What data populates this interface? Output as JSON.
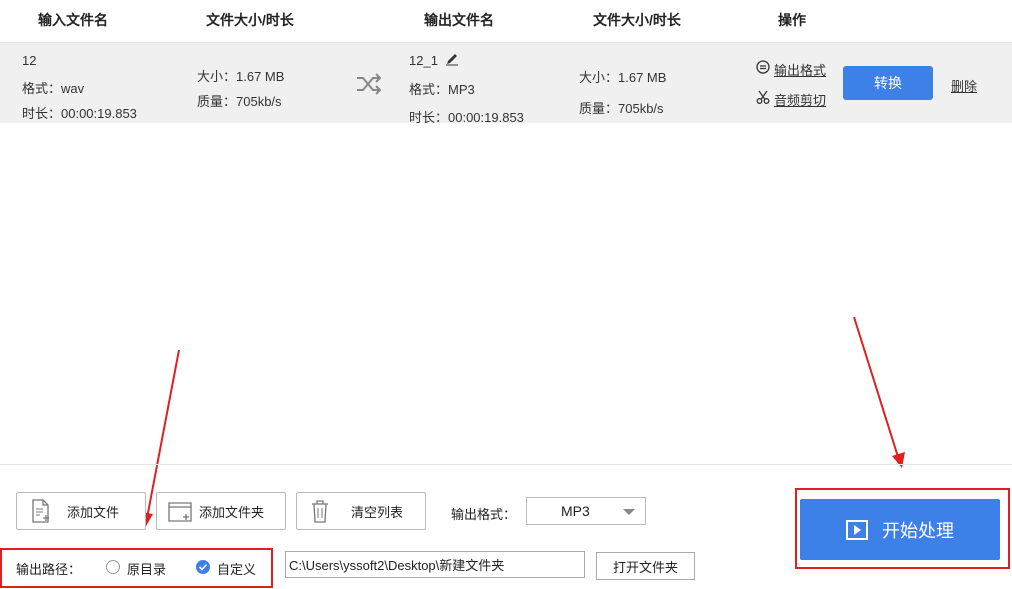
{
  "header": {
    "input_name": "输入文件名",
    "input_size": "文件大小/时长",
    "output_name": "输出文件名",
    "output_size": "文件大小/时长",
    "actions": "操作"
  },
  "file_row": {
    "input_name": "12",
    "input_format": "格式：wav",
    "input_duration": "时长：00:00:19.853",
    "input_size": "大小：1.67 MB",
    "input_quality": "质量：705kb/s",
    "output_name": "12_1",
    "output_format": "格式：MP3",
    "output_duration": "时长：00:00:19.853",
    "output_size": "大小：1.67 MB",
    "output_quality": "质量：705kb/s",
    "output_format_link": "输出格式",
    "audio_cut_link": "音频剪切",
    "convert_button": "转换",
    "delete_link": "删除"
  },
  "toolbar": {
    "add_file": "添加文件",
    "add_folder": "添加文件夹",
    "clear_list": "清空列表",
    "format_label": "输出格式：",
    "format_value": "MP3"
  },
  "output_path": {
    "label": "输出路径：",
    "option_original": "原目录",
    "option_custom": "自定义",
    "selected": "自定义",
    "path_value": "C:\\Users\\yssoft2\\Desktop\\新建文件夹",
    "open_folder_button": "打开文件夹"
  },
  "start_button": "开始处理",
  "colors": {
    "accent": "#3d80e8",
    "annotation": "#e02020",
    "row_bg": "#f0f0f0"
  }
}
